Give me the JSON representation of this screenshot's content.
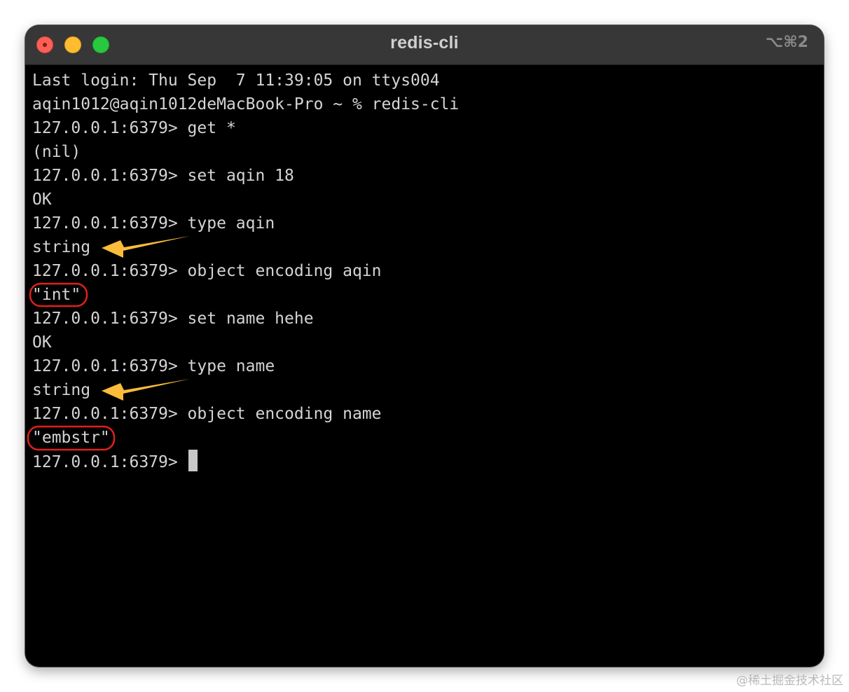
{
  "window": {
    "title": "redis-cli",
    "shortcut": "⌥⌘2"
  },
  "terminal": {
    "lines": [
      "Last login: Thu Sep  7 11:39:05 on ttys004",
      "aqin1012@aqin1012deMacBook-Pro ~ % redis-cli",
      "127.0.0.1:6379> get *",
      "(nil)",
      "127.0.0.1:6379> set aqin 18",
      "OK",
      "127.0.0.1:6379> type aqin",
      "string",
      "127.0.0.1:6379> object encoding aqin",
      "\"int\"",
      "127.0.0.1:6379> set name hehe",
      "OK",
      "127.0.0.1:6379> type name",
      "string",
      "127.0.0.1:6379> object encoding name",
      "\"embstr\"",
      "127.0.0.1:6379> "
    ]
  },
  "annotations": {
    "arrow_color": "#fbbc3c",
    "highlight_color": "#e0201c"
  },
  "watermark": "@稀土掘金技术社区"
}
